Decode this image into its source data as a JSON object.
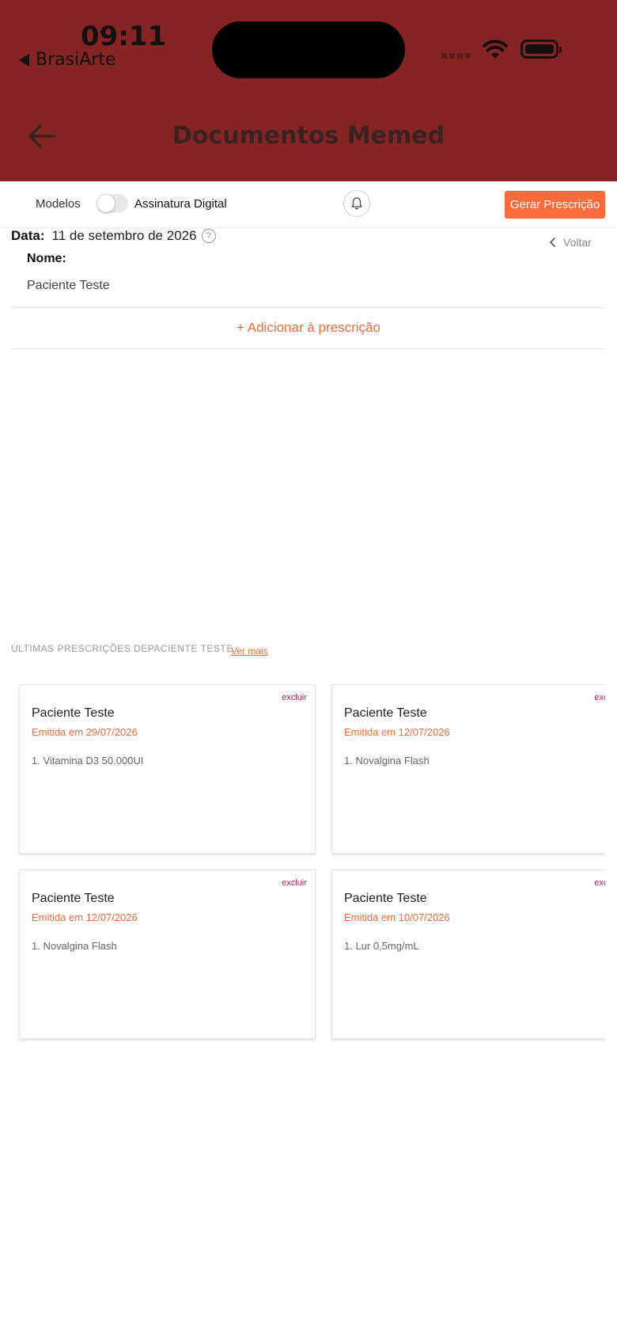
{
  "status_bar": {
    "time": "09:11",
    "back_app": "BrasiArte"
  },
  "nav": {
    "title": "Documentos Memed"
  },
  "toolbar": {
    "modelos": "Modelos",
    "assinatura": "Assinatura Digital",
    "gerar": "Gerar Prescrição",
    "assinatura_enabled": false
  },
  "form": {
    "data_label": "Data:",
    "data_value": "11 de setembro de 2026",
    "help": "?",
    "voltar": "Voltar",
    "nome_label": "Nome:",
    "nome_value": "Paciente Teste",
    "adicionar": "+ Adicionar à prescrição"
  },
  "ultimas": {
    "title": "ÚLTIMAS PRESCRIÇÕES DEPACIENTE TESTE",
    "ver_mais": "Ver mais",
    "cards": [
      {
        "excluir": "excluir",
        "nome": "Paciente Teste",
        "emitida": "Emitida em 29/07/2026",
        "item": "1. Vitamina D3 50.000UI"
      },
      {
        "excluir": "excluir",
        "nome": "Paciente Teste",
        "emitida": "Emitida em 12/07/2026",
        "item": "1. Novalgina Flash"
      },
      {
        "excluir": "excluir",
        "nome": "Paciente Teste",
        "emitida": "Emitida em 12/07/2026",
        "item": "1. Novalgina Flash"
      },
      {
        "excluir": "excluir",
        "nome": "Paciente Teste",
        "emitida": "Emitida em 10/07/2026",
        "item": "1. Lur 0,5mg/mL"
      }
    ]
  },
  "colors": {
    "header_bg": "#862424",
    "accent": "#ff6b3d",
    "excluir": "#c2185b"
  }
}
